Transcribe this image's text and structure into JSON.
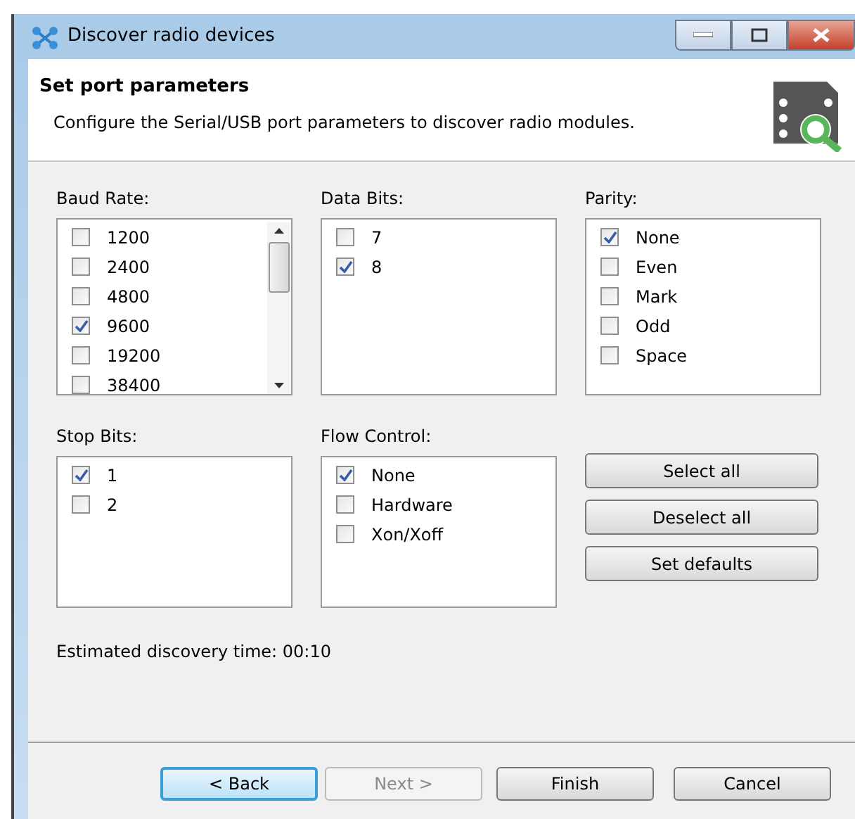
{
  "window": {
    "title": "Discover radio devices"
  },
  "header": {
    "title": "Set port parameters",
    "description": "Configure the Serial/USB port parameters to discover radio modules."
  },
  "groups": [
    {
      "label": "Baud Rate:",
      "scrollable": true,
      "items": [
        {
          "label": "1200",
          "checked": false
        },
        {
          "label": "2400",
          "checked": false
        },
        {
          "label": "4800",
          "checked": false
        },
        {
          "label": "9600",
          "checked": true
        },
        {
          "label": "19200",
          "checked": false
        },
        {
          "label": "38400",
          "checked": false
        }
      ]
    },
    {
      "label": "Data Bits:",
      "scrollable": false,
      "items": [
        {
          "label": "7",
          "checked": false
        },
        {
          "label": "8",
          "checked": true
        }
      ]
    },
    {
      "label": "Parity:",
      "scrollable": false,
      "items": [
        {
          "label": "None",
          "checked": true
        },
        {
          "label": "Even",
          "checked": false
        },
        {
          "label": "Mark",
          "checked": false
        },
        {
          "label": "Odd",
          "checked": false
        },
        {
          "label": "Space",
          "checked": false
        }
      ]
    },
    {
      "label": "Stop Bits:",
      "scrollable": false,
      "items": [
        {
          "label": "1",
          "checked": true
        },
        {
          "label": "2",
          "checked": false
        }
      ]
    },
    {
      "label": "Flow Control:",
      "scrollable": false,
      "items": [
        {
          "label": "None",
          "checked": true
        },
        {
          "label": "Hardware",
          "checked": false
        },
        {
          "label": "Xon/Xoff",
          "checked": false
        }
      ]
    }
  ],
  "side_buttons": [
    "Select all",
    "Deselect all",
    "Set defaults"
  ],
  "estimate": "Estimated discovery time: 00:10",
  "footer_buttons": [
    {
      "label": "< Back",
      "default": true,
      "disabled": false
    },
    {
      "label": "Next >",
      "default": false,
      "disabled": true
    },
    {
      "label": "Finish",
      "default": false,
      "disabled": false
    },
    {
      "label": "Cancel",
      "default": false,
      "disabled": false
    }
  ]
}
